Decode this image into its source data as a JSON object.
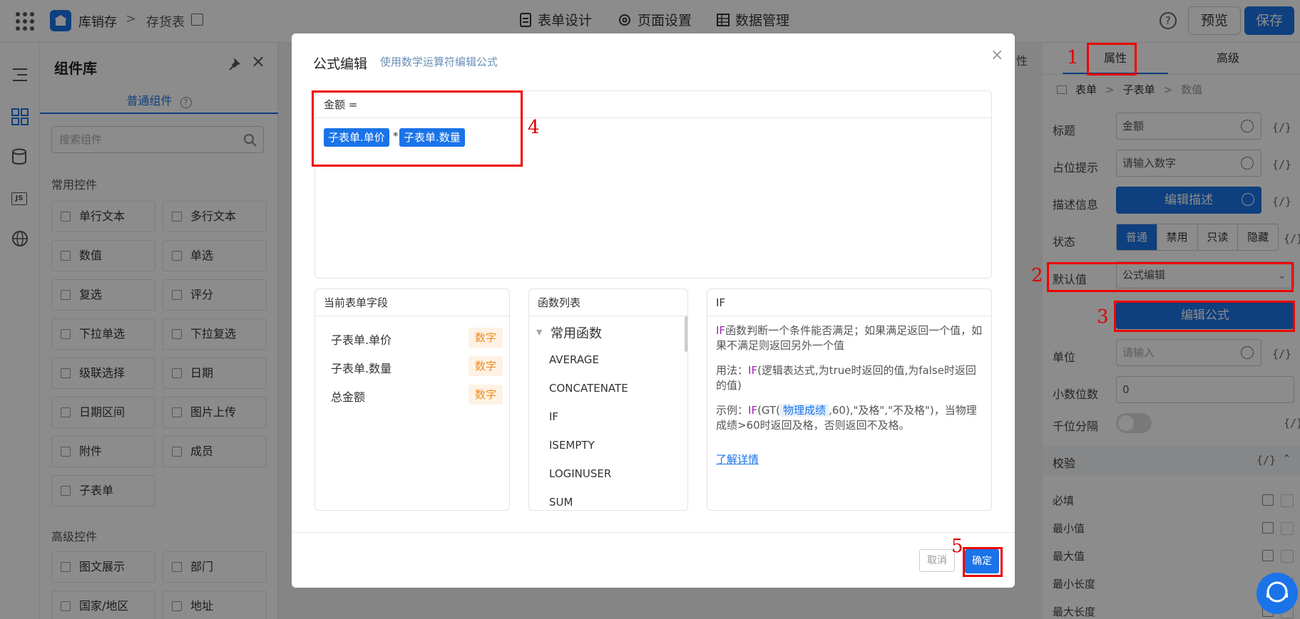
{
  "topbar": {
    "app_name": "库销存",
    "breadcrumb_sep": ">",
    "page_name": "存货表",
    "menu": [
      "表单设计",
      "页面设置",
      "数据管理"
    ],
    "help": "?",
    "preview": "预览",
    "save": "保存"
  },
  "components": {
    "title": "组件库",
    "tab": "普通组件",
    "search_placeholder": "搜索组件",
    "common_header": "常用控件",
    "common_items": [
      "单行文本",
      "多行文本",
      "数值",
      "单选",
      "复选",
      "评分",
      "下拉单选",
      "下拉复选",
      "级联选择",
      "日期",
      "日期区间",
      "图片上传",
      "附件",
      "成员",
      "子表单"
    ],
    "advanced_header": "高级控件",
    "advanced_items": [
      "图文展示",
      "部门",
      "国家/地区",
      "地址"
    ]
  },
  "right_panel": {
    "tabs": [
      "属性",
      "高级"
    ],
    "path": [
      "表单",
      "子表单",
      "数值"
    ],
    "rows": {
      "title_label": "标题",
      "title_value": "金额",
      "placeholder_label": "占位提示",
      "placeholder_value": "请输入数字",
      "desc_label": "描述信息",
      "desc_button": "编辑描述",
      "status_label": "状态",
      "status_options": [
        "普通",
        "禁用",
        "只读",
        "隐藏"
      ],
      "default_label": "默认值",
      "default_value": "公式编辑",
      "formula_button": "编辑公式",
      "unit_label": "单位",
      "unit_placeholder": "请输入",
      "decimal_label": "小数位数",
      "decimal_value": "0",
      "thousand_label": "千位分隔",
      "curly": "{/}"
    },
    "validate": {
      "header": "校验",
      "items": [
        "必填",
        "最小值",
        "最大值",
        "最小长度",
        "最大长度"
      ]
    },
    "canvas_tab_fragment": "性"
  },
  "modal": {
    "title": "公式编辑",
    "subtitle": "使用数学运算符编辑公式",
    "close": "×",
    "formula_head": "金额 =",
    "chip1": "子表单.单价",
    "operator": "*",
    "chip2": "子表单.数量",
    "fields_header": "当前表单字段",
    "fields": [
      {
        "name": "子表单.单价",
        "type": "数字"
      },
      {
        "name": "子表单.数量",
        "type": "数字"
      },
      {
        "name": "总金额",
        "type": "数字"
      }
    ],
    "funcs_header": "函数列表",
    "func_group": "常用函数",
    "funcs": [
      "AVERAGE",
      "CONCATENATE",
      "IF",
      "ISEMPTY",
      "LOGINUSER",
      "SUM"
    ],
    "info_header": "IF",
    "info_fn": "IF",
    "info_desc": "函数判断一个条件能否满足；如果满足返回一个值，如果不满足则返回另外一个值",
    "usage_prefix": "用法：",
    "usage_body": "(逻辑表达式,为true时返回的值,为false时返回的值)",
    "example_prefix": "示例：",
    "example_mid": "(GT(",
    "example_chip": "物理成绩",
    "example_tail": ",60),\"及格\",\"不及格\")，当物理成绩>60时返回及格，否则返回不及格。",
    "learn_more": "了解详情",
    "cancel": "取消",
    "ok": "确定"
  },
  "annotations": [
    "1",
    "2",
    "3",
    "4",
    "5"
  ]
}
